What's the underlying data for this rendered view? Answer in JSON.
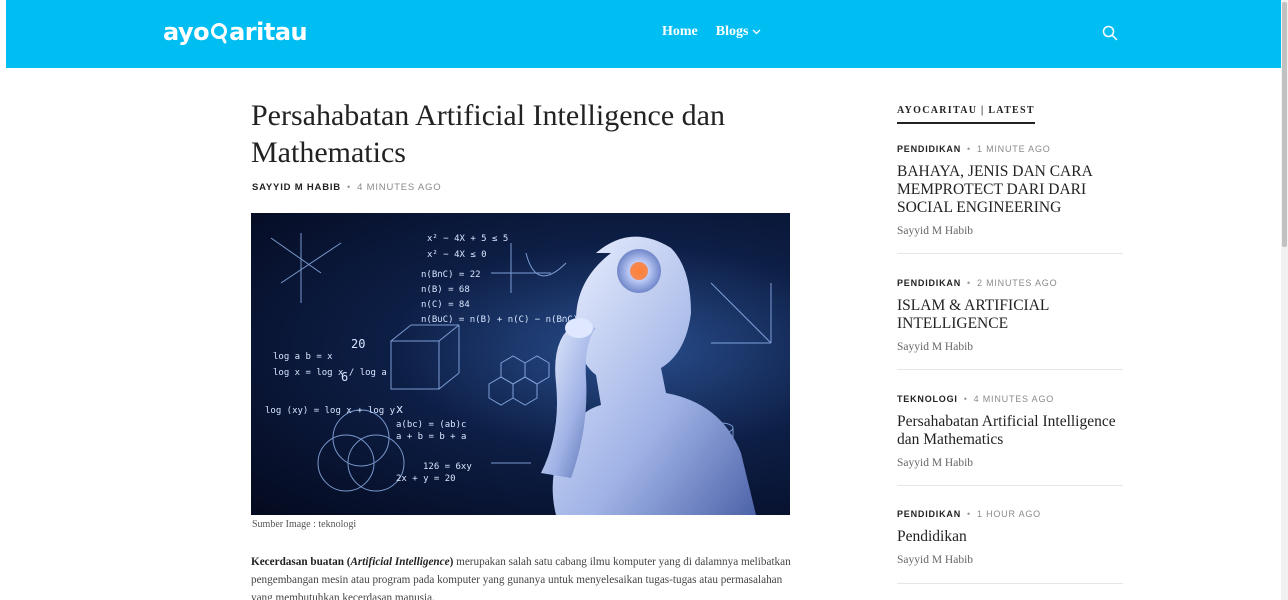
{
  "header": {
    "logo_left": "ayo",
    "logo_right": "aritau",
    "nav": [
      {
        "label": "Home"
      },
      {
        "label": "Blogs"
      }
    ]
  },
  "article": {
    "title": "Persahabatan Artificial Intelligence dan Mathematics",
    "author": "SAYYID M HABIB",
    "time": "4 MINUTES AGO",
    "caption": "Sumber Image : teknologi",
    "body_bold_1": "Kecerdasan buatan (",
    "body_bold_italic": "Artificial Intelligence",
    "body_bold_2": ")",
    "body_rest": " merupakan salah satu cabang ilmu komputer yang di dalamnya melibatkan pengembangan mesin atau program pada komputer yang gunanya untuk menyelesaikan tugas-tugas atau permasalahan yang membutuhkan kecerdasan manusia."
  },
  "sidebar": {
    "heading": "AYOCARITAU | LATEST",
    "items": [
      {
        "category": "PENDIDIKAN",
        "time": "1 MINUTE AGO",
        "title": "BAHAYA, JENIS DAN CARA MEMPROTECT DARI DARI SOCIAL ENGINEERING",
        "author": "Sayyid M Habib"
      },
      {
        "category": "PENDIDIKAN",
        "time": "2 MINUTES AGO",
        "title": "ISLAM & ARTIFICIAL INTELLIGENCE",
        "author": "Sayyid M Habib"
      },
      {
        "category": "TEKNOLOGI",
        "time": "4 MINUTES AGO",
        "title": "Persahabatan Artificial Intelligence dan Mathematics",
        "author": "Sayyid M Habib"
      },
      {
        "category": "PENDIDIKAN",
        "time": "1 HOUR AGO",
        "title": "Pendidikan",
        "author": "Sayyid M Habib"
      }
    ]
  },
  "hero_text": {
    "math": [
      "x² − 4X + 5 ≤ 5",
      "x² − 4X ≤ 0",
      "n(B∩C) = 22",
      "n(B) = 68",
      "n(C) = 84",
      "n(B∪C) = n(B) + n(C) − n(B∩C)",
      "log a b = x",
      "log x = log x / log a",
      "log (xy) = log x + log y",
      "a(bc) = (ab)c",
      "a + b = b + a",
      "126 = 6xy",
      "2x + y = 20",
      "20",
      "6",
      "x"
    ]
  },
  "colors": {
    "header_bg": "#00bdf2",
    "text": "#222222",
    "muted": "#8a8a8a"
  }
}
